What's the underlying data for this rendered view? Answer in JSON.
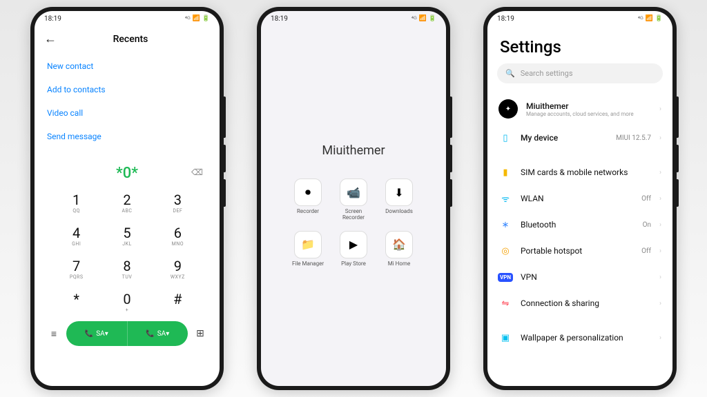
{
  "status": {
    "time": "18:19"
  },
  "dialer": {
    "title": "Recents",
    "links": [
      "New contact",
      "Add to contacts",
      "Video call",
      "Send message"
    ],
    "entered": "*0*",
    "keys": [
      {
        "d": "1",
        "l": "QQ"
      },
      {
        "d": "2",
        "l": "ABC"
      },
      {
        "d": "3",
        "l": "DEF"
      },
      {
        "d": "4",
        "l": "GHI"
      },
      {
        "d": "5",
        "l": "JKL"
      },
      {
        "d": "6",
        "l": "MNO"
      },
      {
        "d": "7",
        "l": "PQRS"
      },
      {
        "d": "8",
        "l": "TUV"
      },
      {
        "d": "9",
        "l": "WXYZ"
      },
      {
        "d": "*",
        "l": ""
      },
      {
        "d": "0",
        "l": "+"
      },
      {
        "d": "#",
        "l": ""
      }
    ],
    "sim1": "SA▾",
    "sim2": "SA▾"
  },
  "home": {
    "title": "Miuithemer",
    "apps": [
      {
        "label": "Recorder",
        "icon": "⏺"
      },
      {
        "label": "Screen Recorder",
        "icon": "📹"
      },
      {
        "label": "Downloads",
        "icon": "⬇"
      },
      {
        "label": "File Manager",
        "icon": "📁"
      },
      {
        "label": "Play Store",
        "icon": "▶"
      },
      {
        "label": "Mi Home",
        "icon": "🏠"
      }
    ]
  },
  "settings": {
    "title": "Settings",
    "search_placeholder": "Search settings",
    "account": {
      "name": "Miuithemer",
      "sub": "Manage accounts, cloud services, and more"
    },
    "device": {
      "label": "My device",
      "value": "MIUI 12.5.7"
    },
    "rows": [
      {
        "icon_cls": "ic-sim",
        "glyph": "▮",
        "label": "SIM cards & mobile networks",
        "value": ""
      },
      {
        "icon_cls": "ic-wifi",
        "glyph": "ᯤ",
        "label": "WLAN",
        "value": "Off"
      },
      {
        "icon_cls": "ic-bt",
        "glyph": "∗",
        "label": "Bluetooth",
        "value": "On"
      },
      {
        "icon_cls": "ic-hot",
        "glyph": "◎",
        "label": "Portable hotspot",
        "value": "Off"
      },
      {
        "icon_cls": "",
        "glyph": "VPN",
        "label": "VPN",
        "value": "",
        "vpn": true
      },
      {
        "icon_cls": "ic-con",
        "glyph": "⇋",
        "label": "Connection & sharing",
        "value": ""
      }
    ],
    "rows2": [
      {
        "icon_cls": "ic-wall",
        "glyph": "▣",
        "label": "Wallpaper & personalization",
        "value": ""
      }
    ]
  }
}
